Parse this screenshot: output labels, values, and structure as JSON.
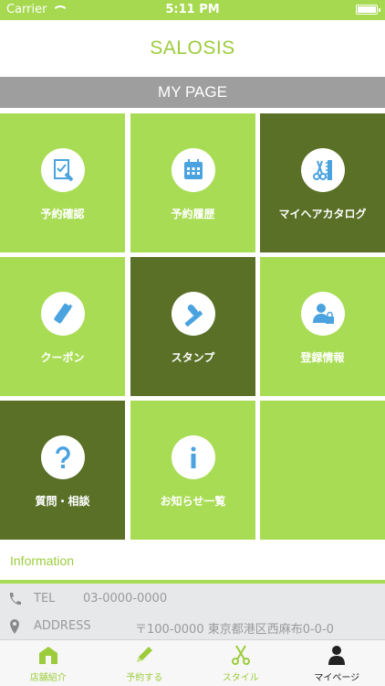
{
  "status_bar": {
    "carrier": "Carrier",
    "time": "5:11 PM"
  },
  "header": {
    "title": "SALOSIS"
  },
  "section": {
    "title": "MY PAGE"
  },
  "colors": {
    "accent": "#a9dc55",
    "dark": "#597026",
    "icon": "#4aa3df"
  },
  "tiles": [
    {
      "label": "予約確認",
      "icon": "checklist-icon"
    },
    {
      "label": "予約履歴",
      "icon": "calendar-icon"
    },
    {
      "label": "マイヘアカタログ",
      "icon": "scissors-comb-icon"
    },
    {
      "label": "クーポン",
      "icon": "coupon-icon"
    },
    {
      "label": "スタンプ",
      "icon": "stamp-icon"
    },
    {
      "label": "登録情報",
      "icon": "user-lock-icon"
    },
    {
      "label": "質問・相談",
      "icon": "question-icon"
    },
    {
      "label": "お知らせ一覧",
      "icon": "info-icon"
    }
  ],
  "information": {
    "title": "Information",
    "tel_label": "TEL",
    "tel_value": "03-0000-0000",
    "address_label": "ADDRESS",
    "address_value": "〒100-0000 東京都港区西麻布0-0-0"
  },
  "tabs": [
    {
      "label": "店舗紹介",
      "icon": "shop-icon"
    },
    {
      "label": "予約する",
      "icon": "pencil-icon"
    },
    {
      "label": "スタイル",
      "icon": "scissors-icon"
    },
    {
      "label": "マイページ",
      "icon": "person-icon"
    }
  ]
}
